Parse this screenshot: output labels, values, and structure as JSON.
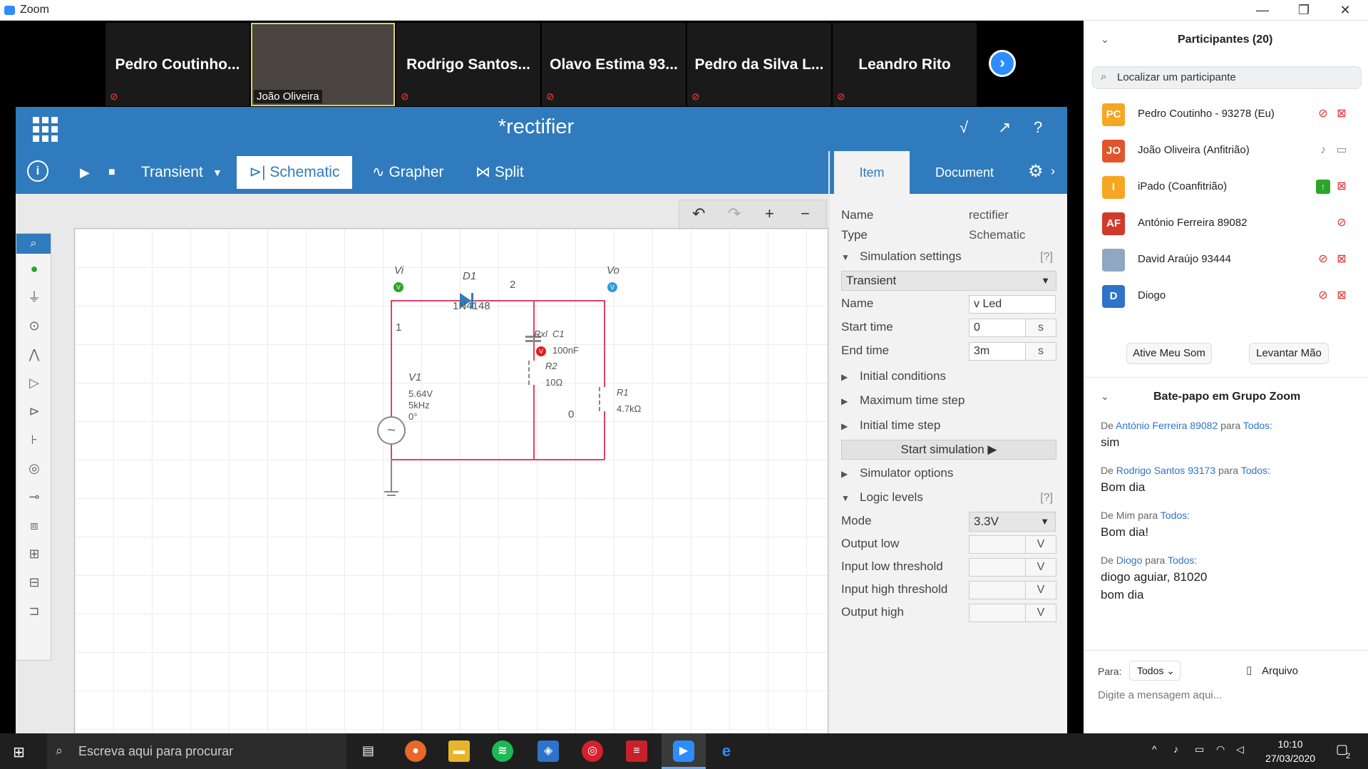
{
  "window": {
    "title": "Zoom",
    "minimize": "—",
    "restore": "❐",
    "close": "✕"
  },
  "gallery": {
    "tiles": [
      "Pedro Coutinho...",
      "João Oliveira",
      "Rodrigo Santos...",
      "Olavo Estima 93...",
      "Pedro da Silva L...",
      "Leandro Rito"
    ],
    "next": "›"
  },
  "app": {
    "title": "*rectifier",
    "toolbar": {
      "info": "i",
      "play": "▶",
      "stop": "■",
      "mode": "Transient",
      "dropdown": "▼",
      "tab_schematic": "Schematic",
      "tab_grapher": "Grapher",
      "tab_split": "Split"
    },
    "undobar": {
      "undo": "↶",
      "redo": "↷",
      "zoom_in": "+",
      "zoom_out": "−"
    },
    "header_icons": [
      "√",
      "↗",
      "?"
    ]
  },
  "schematic": {
    "vi": "Vi",
    "vo": "Vo",
    "d1": "D1",
    "d1_model": "1N4148",
    "node2": "2",
    "node1": "1",
    "node0": "0",
    "v1": "V1",
    "v1_amp": "5.64V",
    "v1_freq": "5kHz",
    "v1_phase": "0°",
    "rxl": "Rxl",
    "c1": "C1",
    "c1_val": "100nF",
    "r2": "R2",
    "r2_val": "10Ω",
    "r1": "R1",
    "r1_val": "4.7kΩ",
    "probe_v": "V"
  },
  "props": {
    "tab_item": "Item",
    "tab_document": "Document",
    "name_label": "Name",
    "name_value": "rectifier",
    "type_label": "Type",
    "type_value": "Schematic",
    "sim_settings": "Simulation settings",
    "help": "[?]",
    "sim_mode": "Transient",
    "sim_name_label": "Name",
    "sim_name_value": "v Led",
    "start_time_label": "Start time",
    "start_time_value": "0",
    "start_time_unit": "s",
    "end_time_label": "End time",
    "end_time_value": "3m",
    "end_time_unit": "s",
    "initial_conditions": "Initial conditions",
    "max_time_step": "Maximum time step",
    "initial_time_step": "Initial time step",
    "start_simulation": "Start simulation ▶",
    "simulator_options": "Simulator options",
    "logic_levels": "Logic levels",
    "mode_label": "Mode",
    "mode_value": "3.3V",
    "output_low": "Output low",
    "input_low": "Input low threshold",
    "input_high": "Input high threshold",
    "output_high": "Output high",
    "unit_v": "V"
  },
  "participants": {
    "header": "Participantes (20)",
    "search_placeholder": "Localizar um participante",
    "list": [
      {
        "initials": "PC",
        "color": "#f5a623",
        "name": "Pedro Coutinho - 93278 (Eu)"
      },
      {
        "initials": "JO",
        "color": "#e0562c",
        "name": "João Oliveira (Anfitrião)"
      },
      {
        "initials": "I",
        "color": "#f5a623",
        "name": "iPado (Coanfitrião)"
      },
      {
        "initials": "AF",
        "color": "#d03a2a",
        "name": "António Ferreira 89082"
      },
      {
        "initials": "",
        "color": "#8fa7c0",
        "name": "David Araújo 93444"
      },
      {
        "initials": "D",
        "color": "#2d73c9",
        "name": "Diogo"
      }
    ],
    "unmute_btn": "Ative Meu Som",
    "raise_hand_btn": "Levantar Mão"
  },
  "chat": {
    "header": "Bate-papo em Grupo Zoom",
    "messages": [
      {
        "from_prefix": "De",
        "from": "António Ferreira 89082",
        "to_prefix": "para",
        "to": "Todos:",
        "text": [
          "sim"
        ]
      },
      {
        "from_prefix": "De",
        "from": "Rodrigo Santos 93173",
        "to_prefix": "para",
        "to": "Todos:",
        "text": [
          "Bom dia"
        ]
      },
      {
        "from_prefix": "De Mim",
        "from": "",
        "to_prefix": "para",
        "to": "Todos:",
        "text": [
          "Bom dia!"
        ]
      },
      {
        "from_prefix": "De",
        "from": "Diogo",
        "to_prefix": "para",
        "to": "Todos:",
        "text": [
          "diogo aguiar, 81020",
          "bom dia"
        ]
      }
    ],
    "to_label": "Para:",
    "to_value": "Todos",
    "file_label": "Arquivo",
    "input_placeholder": "Digite a mensagem aqui..."
  },
  "taskbar": {
    "search_placeholder": "Escreva aqui para procurar",
    "time": "10:10",
    "date": "27/03/2020",
    "notifications": "2"
  }
}
